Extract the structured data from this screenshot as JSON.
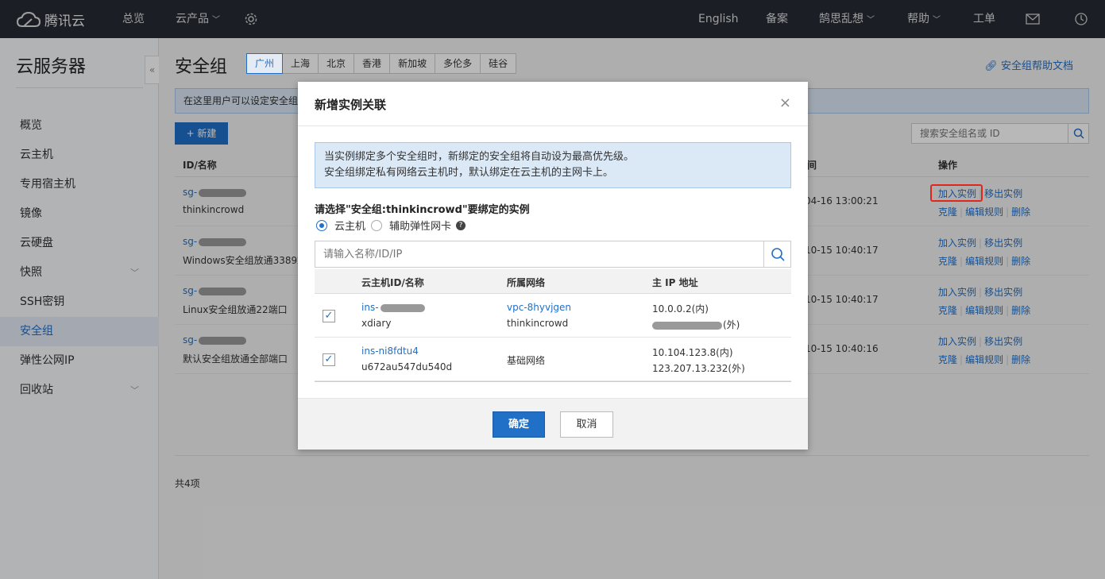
{
  "topbar": {
    "logo": "腾讯云",
    "overview": "总览",
    "products": "云产品",
    "english": "English",
    "beian": "备案",
    "user": "鹄思乱想",
    "help": "帮助",
    "ticket": "工单"
  },
  "sidebar": {
    "title": "云服务器",
    "collapse": "«",
    "items": [
      {
        "label": "概览"
      },
      {
        "label": "云主机"
      },
      {
        "label": "专用宿主机"
      },
      {
        "label": "镜像"
      },
      {
        "label": "云硬盘"
      },
      {
        "label": "快照"
      },
      {
        "label": "SSH密钥"
      },
      {
        "label": "安全组"
      },
      {
        "label": "弹性公网IP"
      },
      {
        "label": "回收站"
      }
    ]
  },
  "main": {
    "title": "安全组",
    "regions": [
      "广州",
      "上海",
      "北京",
      "香港",
      "新加坡",
      "多伦多",
      "硅谷"
    ],
    "help_link": "安全组帮助文档",
    "notice": "在这里用户可以设定安全组",
    "new_button": "+ 新建",
    "search_placeholder": "搜索安全组名或 ID",
    "columns": {
      "id_name": "ID/名称",
      "time": "间",
      "ops": "操作"
    },
    "rows": [
      {
        "id": "sg-",
        "name": "thinkincrowd",
        "time": "04-16 13:00:21"
      },
      {
        "id": "sg-",
        "name": "Windows安全组放通3389端",
        "time": "10-15 10:40:17"
      },
      {
        "id": "sg-",
        "name": "Linux安全组放通22端口",
        "time": "10-15 10:40:17"
      },
      {
        "id": "sg-",
        "name": "默认安全组放通全部端口",
        "time": "10-15 10:40:16"
      }
    ],
    "ops": {
      "add": "加入实例",
      "remove": "移出实例",
      "clone": "克隆",
      "edit": "编辑规则",
      "delete": "删除"
    },
    "total": "共4项"
  },
  "dialog": {
    "title": "新增实例关联",
    "close": "×",
    "tip_line1": "当实例绑定多个安全组时，新绑定的安全组将自动设为最高优先级。",
    "tip_line2": "安全组绑定私有网络云主机时，默认绑定在云主机的主网卡上。",
    "select_label": "请选择\"安全组:thinkincrowd\"要绑定的实例",
    "radio_cvm": "云主机",
    "radio_eni": "辅助弹性网卡",
    "qmark": "?",
    "search_placeholder": "请输入名称/ID/IP",
    "columns": {
      "id_name": "云主机ID/名称",
      "network": "所属网络",
      "ip": "主 IP 地址"
    },
    "rows": [
      {
        "id": "ins-",
        "name": "xdiary",
        "network": "vpc-8hyvjgen",
        "network_name": "thinkincrowd",
        "ip_in": "10.0.0.2(内)",
        "ip_out": "(外)"
      },
      {
        "id": "ins-ni8fdtu4",
        "name": "u672au547du540d",
        "network": "基础网络",
        "ip_in": "10.104.123.8(内)",
        "ip_out": "123.207.13.232(外)"
      }
    ],
    "ok": "确定",
    "cancel": "取消"
  }
}
